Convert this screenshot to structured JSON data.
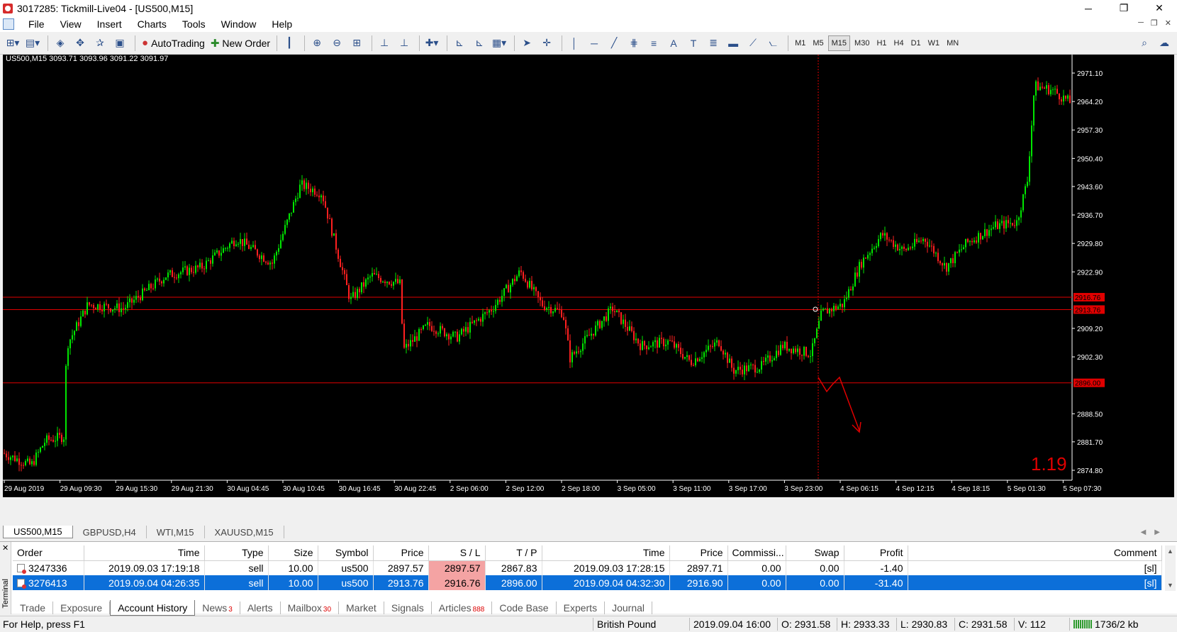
{
  "window": {
    "title": "3017285: Tickmill-Live04 - [US500,M15]",
    "buttons": {
      "minimize": "─",
      "restore": "❐",
      "close": "✕"
    }
  },
  "menu": [
    "File",
    "View",
    "Insert",
    "Charts",
    "Tools",
    "Window",
    "Help"
  ],
  "toolbar": {
    "autotrading_label": "AutoTrading",
    "new_order_label": "New Order",
    "timeframes": [
      "M1",
      "M5",
      "M15",
      "M30",
      "H1",
      "H4",
      "D1",
      "W1",
      "MN"
    ],
    "active_timeframe": "M15"
  },
  "chart": {
    "info": "US500,M15  3093.71 3093.96 3091.22 3091.97",
    "price_labels": [
      "2971.10",
      "2964.20",
      "2957.30",
      "2950.40",
      "2943.60",
      "2936.70",
      "2929.80",
      "2922.90",
      "2909.20",
      "2902.30",
      "2888.50",
      "2881.70",
      "2874.80"
    ],
    "time_labels": [
      "29 Aug 2019",
      "29 Aug 09:30",
      "29 Aug 15:30",
      "29 Aug 21:30",
      "30 Aug 04:45",
      "30 Aug 10:45",
      "30 Aug 16:45",
      "30 Aug 22:45",
      "2 Sep 06:00",
      "2 Sep 12:00",
      "2 Sep 18:00",
      "3 Sep 05:00",
      "3 Sep 11:00",
      "3 Sep 17:00",
      "3 Sep 23:00",
      "4 Sep 06:15",
      "4 Sep 12:15",
      "4 Sep 18:15",
      "5 Sep 01:30",
      "5 Sep 07:30"
    ],
    "level_labels": [
      "2916.76",
      "2913.76",
      "2896.00"
    ],
    "spread": "1.19",
    "colors": {
      "bull": "#00e600",
      "bear": "#ff2020",
      "level": "#e00000",
      "background": "#000000"
    }
  },
  "chart_tabs": [
    "US500,M15",
    "GBPUSD,H4",
    "WTI,M15",
    "XAUUSD,M15"
  ],
  "active_chart_tab": "US500,M15",
  "terminal": {
    "side_label": "Terminal",
    "columns": [
      "Order",
      "Time",
      "Type",
      "Size",
      "Symbol",
      "Price",
      "S / L",
      "T / P",
      "Time",
      "Price",
      "Commissi...",
      "Swap",
      "Profit",
      "Comment"
    ],
    "rows": [
      [
        "3247336",
        "2019.09.03 17:19:18",
        "sell",
        "10.00",
        "us500",
        "2897.57",
        "2897.57",
        "2867.83",
        "2019.09.03 17:28:15",
        "2897.71",
        "0.00",
        "0.00",
        "-1.40",
        "[sl]"
      ],
      [
        "3276413",
        "2019.09.04 04:26:35",
        "sell",
        "10.00",
        "us500",
        "2913.76",
        "2916.76",
        "2896.00",
        "2019.09.04 04:32:30",
        "2916.90",
        "0.00",
        "0.00",
        "-31.40",
        "[sl]"
      ]
    ],
    "tabs": [
      {
        "label": "Trade",
        "badge": ""
      },
      {
        "label": "Exposure",
        "badge": ""
      },
      {
        "label": "Account History",
        "badge": ""
      },
      {
        "label": "News",
        "badge": "3"
      },
      {
        "label": "Alerts",
        "badge": ""
      },
      {
        "label": "Mailbox",
        "badge": "30"
      },
      {
        "label": "Market",
        "badge": ""
      },
      {
        "label": "Signals",
        "badge": ""
      },
      {
        "label": "Articles",
        "badge": "888"
      },
      {
        "label": "Code Base",
        "badge": ""
      },
      {
        "label": "Experts",
        "badge": ""
      },
      {
        "label": "Journal",
        "badge": ""
      }
    ],
    "active_tab": "Account History"
  },
  "statusbar": {
    "help": "For Help, press F1",
    "profile": "British Pound",
    "datetime": "2019.09.04 16:00",
    "open": "O: 2931.58",
    "high": "H: 2933.33",
    "low": "L: 2930.83",
    "close": "C: 2931.58",
    "volume": "V: 112",
    "traffic": "1736/2 kb"
  }
}
